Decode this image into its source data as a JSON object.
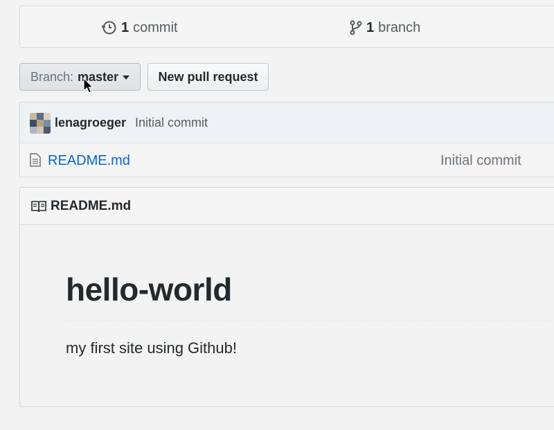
{
  "summary": {
    "commits_count": "1",
    "commits_label": "commit",
    "branches_count": "1",
    "branches_label": "branch"
  },
  "toolbar": {
    "branch_label": "Branch:",
    "branch_value": "master",
    "new_pr_label": "New pull request"
  },
  "latest_commit": {
    "author": "lenagroeger",
    "message": "Initial commit"
  },
  "files": [
    {
      "name": "README.md",
      "commit_message": "Initial commit",
      "icon": "file-icon"
    }
  ],
  "readme": {
    "title": "README.md",
    "heading": "hello-world",
    "paragraph": "my first site using Github!"
  },
  "colors": {
    "link": "#0366d6",
    "text": "#24292e",
    "muted": "#6a737d"
  }
}
